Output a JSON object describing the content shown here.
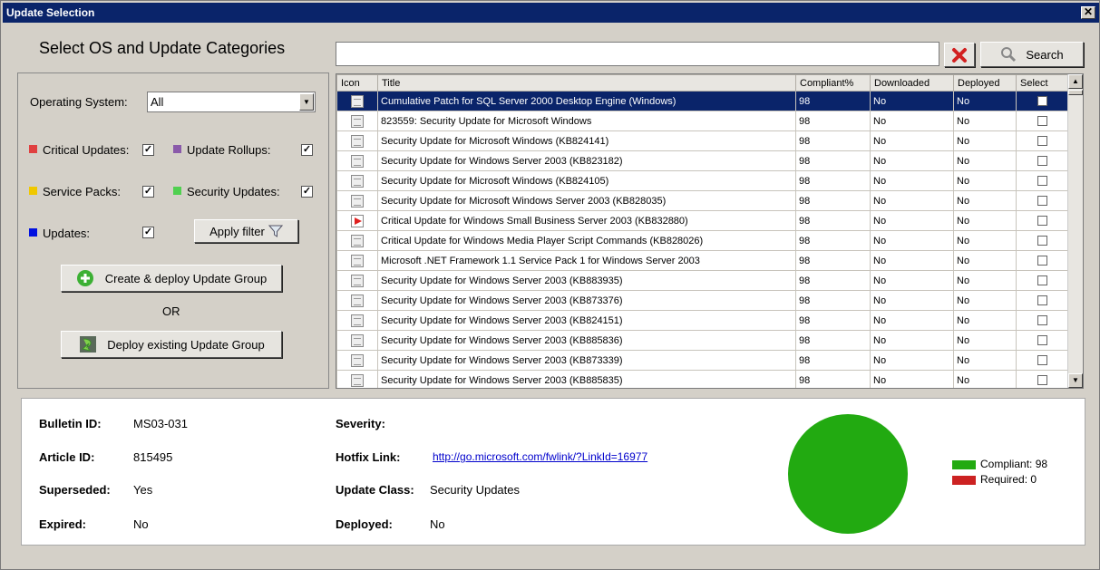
{
  "window": {
    "title": "Update Selection",
    "close_glyph": "✕"
  },
  "left": {
    "heading": "Select OS and Update Categories",
    "os_label": "Operating System:",
    "os_value": "All",
    "categories": [
      {
        "label": "Critical Updates:",
        "color": "#e04040",
        "checked": true
      },
      {
        "label": "Update Rollups:",
        "color": "#8a5aaa",
        "checked": true
      },
      {
        "label": "Service Packs:",
        "color": "#f0c800",
        "checked": true
      },
      {
        "label": "Security Updates:",
        "color": "#50d050",
        "checked": true
      },
      {
        "label": "Updates:",
        "color": "#0010e0",
        "checked": true
      }
    ],
    "check_glyph": "✓",
    "apply_filter": "Apply filter",
    "create_deploy": "Create & deploy Update Group",
    "or": "OR",
    "deploy_existing": "Deploy existing Update Group"
  },
  "search": {
    "value": "",
    "button": "Search"
  },
  "grid": {
    "columns": [
      "Icon",
      "Title",
      "Compliant%",
      "Downloaded",
      "Deployed",
      "Select"
    ],
    "rows": [
      {
        "title": "Cumulative Patch for SQL Server 2000 Desktop Engine (Windows)",
        "compliant": "98",
        "downloaded": "No",
        "deployed": "No",
        "selected": true
      },
      {
        "title": "823559: Security Update for Microsoft Windows",
        "compliant": "98",
        "downloaded": "No",
        "deployed": "No"
      },
      {
        "title": "Security Update for Microsoft Windows (KB824141)",
        "compliant": "98",
        "downloaded": "No",
        "deployed": "No"
      },
      {
        "title": "Security Update for Windows Server 2003 (KB823182)",
        "compliant": "98",
        "downloaded": "No",
        "deployed": "No"
      },
      {
        "title": "Security Update for Microsoft Windows (KB824105)",
        "compliant": "98",
        "downloaded": "No",
        "deployed": "No"
      },
      {
        "title": "Security Update for Microsoft Windows Server 2003 (KB828035)",
        "compliant": "98",
        "downloaded": "No",
        "deployed": "No"
      },
      {
        "title": "Critical Update for Windows Small Business Server 2003 (KB832880)",
        "compliant": "98",
        "downloaded": "No",
        "deployed": "No",
        "critical": true
      },
      {
        "title": "Critical Update for Windows Media Player Script Commands (KB828026)",
        "compliant": "98",
        "downloaded": "No",
        "deployed": "No"
      },
      {
        "title": "Microsoft .NET Framework 1.1 Service Pack 1 for Windows Server 2003",
        "compliant": "98",
        "downloaded": "No",
        "deployed": "No"
      },
      {
        "title": "Security Update for Windows Server 2003 (KB883935)",
        "compliant": "98",
        "downloaded": "No",
        "deployed": "No"
      },
      {
        "title": "Security Update for Windows Server 2003 (KB873376)",
        "compliant": "98",
        "downloaded": "No",
        "deployed": "No"
      },
      {
        "title": "Security Update for Windows Server 2003 (KB824151)",
        "compliant": "98",
        "downloaded": "No",
        "deployed": "No"
      },
      {
        "title": "Security Update for Windows Server 2003 (KB885836)",
        "compliant": "98",
        "downloaded": "No",
        "deployed": "No"
      },
      {
        "title": "Security Update for Windows Server 2003 (KB873339)",
        "compliant": "98",
        "downloaded": "No",
        "deployed": "No"
      },
      {
        "title": "Security Update for Windows Server 2003 (KB885835)",
        "compliant": "98",
        "downloaded": "No",
        "deployed": "No"
      }
    ]
  },
  "details": {
    "bulletin_label": "Bulletin ID:",
    "bulletin_value": "MS03-031",
    "article_label": "Article ID:",
    "article_value": "815495",
    "superseded_label": "Superseded:",
    "superseded_value": "Yes",
    "expired_label": "Expired:",
    "expired_value": "No",
    "severity_label": "Severity:",
    "severity_value": "",
    "hotfix_label": "Hotfix Link:",
    "hotfix_value": "http://go.microsoft.com/fwlink/?LinkId=16977",
    "class_label": "Update Class:",
    "class_value": "Security Updates",
    "deployed_label": "Deployed:",
    "deployed_value": "No"
  },
  "chart_data": {
    "type": "pie",
    "slices": [
      {
        "label": "Compliant: 98",
        "value": 98,
        "color": "#22aa11"
      },
      {
        "label": "Required: 0",
        "value": 0,
        "color": "#cc2222"
      }
    ]
  },
  "colors": {
    "accent": "#0a246a",
    "link": "#0000cc"
  }
}
